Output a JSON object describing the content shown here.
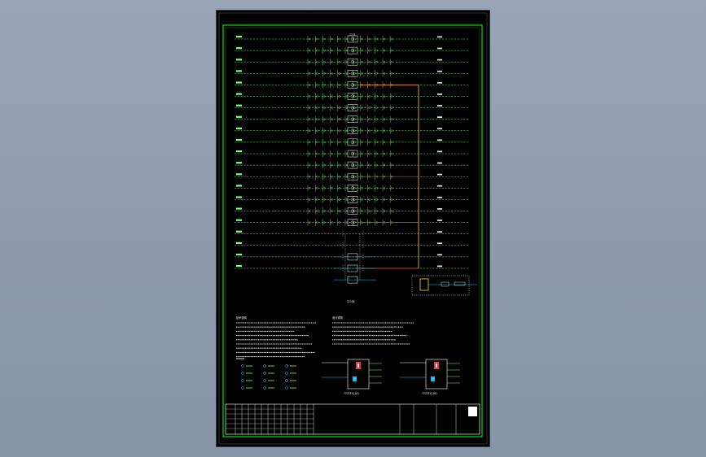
{
  "sheet": {
    "frame_color": "#00e000",
    "wire_color": "#7cff7c",
    "bus_color": "#ffd000",
    "tap_color": "#ff3030",
    "symbol_color": "#00c8ff"
  },
  "schematic": {
    "top_label": "7771",
    "bottom_label": "12156",
    "row_count": 21,
    "tap_rows": [
      4,
      12,
      16,
      20
    ]
  },
  "notes": {
    "left_heading": "技术说明",
    "right_heading": "设计说明"
  },
  "module_1": {
    "caption": "7771FX(1A)"
  },
  "module_2": {
    "caption": "7771FX(1B)"
  }
}
